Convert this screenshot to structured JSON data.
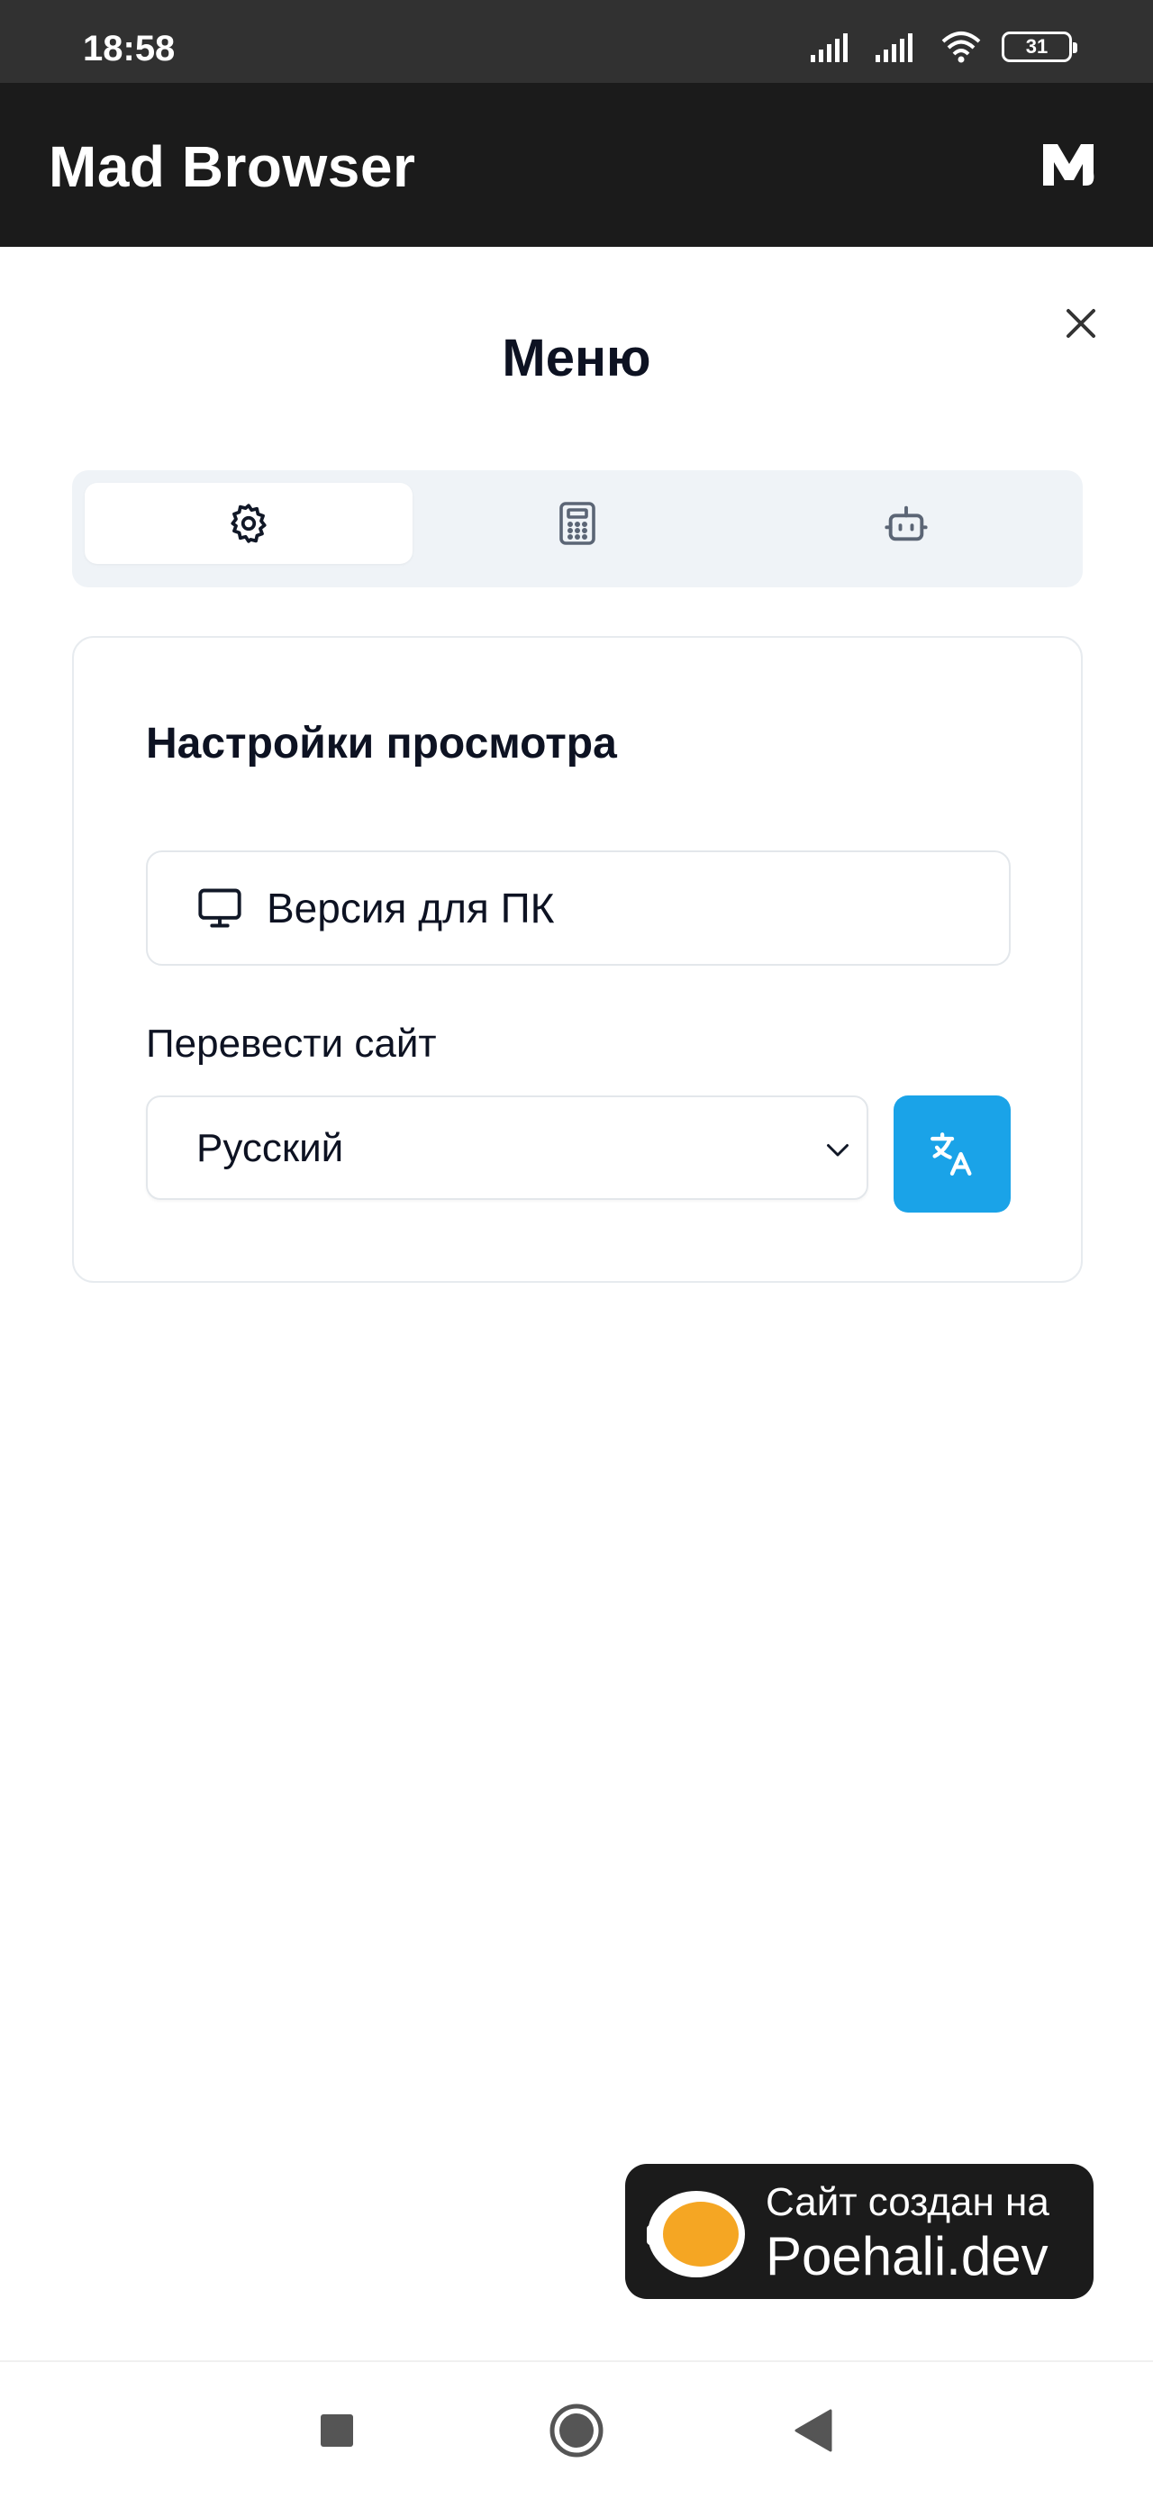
{
  "status_bar": {
    "time": "18:58",
    "battery": "31"
  },
  "app_bar": {
    "title": "Mad Browser",
    "logo_icon": "mad-logo-icon"
  },
  "menu": {
    "title": "Меню",
    "tabs": [
      {
        "icon": "settings-gear-icon",
        "active": true
      },
      {
        "icon": "calculator-icon",
        "active": false
      },
      {
        "icon": "robot-icon",
        "active": false
      }
    ]
  },
  "view_settings": {
    "title": "Настройки просмотра",
    "desktop_button": {
      "icon": "monitor-icon",
      "label": "Версия для ПК"
    },
    "translate_label": "Перевести сайт",
    "language_select": {
      "value": "Русский"
    },
    "translate_button_icon": "translate-icon"
  },
  "badge": {
    "line1": "Сайт создан на",
    "line2": "Poehali.dev"
  },
  "colors": {
    "appbar": "#1b1b1b",
    "statusbar": "#313131",
    "accent": "#1aa3e8",
    "badge_orange": "#f5a623"
  }
}
